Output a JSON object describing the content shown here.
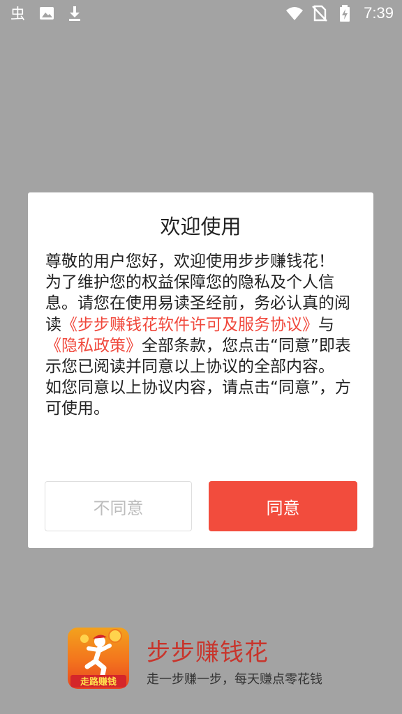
{
  "status_bar": {
    "time": "7:39",
    "left_icons": [
      "app-notification-icon",
      "image-icon",
      "download-icon"
    ],
    "right_icons": [
      "wifi-icon",
      "no-sim-icon",
      "battery-charging-icon"
    ]
  },
  "dialog": {
    "title": "欢迎使用",
    "text_1": "尊敬的用户您好，欢迎使用步步赚钱花！",
    "text_2": "为了维护您的权益保障您的隐私及个人信息。请您在使用易读圣经前，务必认真的阅读",
    "link_service": "《步步赚钱花软件许可及服务协议》",
    "text_and": "与",
    "link_privacy": "《隐私政策》",
    "text_3": "全部条款，您点击“同意”即表示您已阅读并同意以上协议的全部内容。",
    "text_4": "如您同意以上协议内容，请点击“同意”，方可使用。",
    "disagree_label": "不同意",
    "agree_label": "同意"
  },
  "footer": {
    "logo_text": "走路赚钱",
    "app_name": "步步赚钱花",
    "slogan": "走一步赚一步，每天赚点零花钱"
  },
  "colors": {
    "overlay": "#a3a3a3",
    "accent": "#f24c3d",
    "link": "#f0483c",
    "brand": "#c8352c"
  }
}
